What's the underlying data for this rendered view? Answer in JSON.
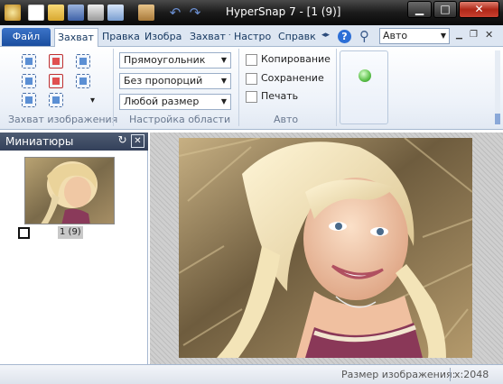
{
  "window": {
    "title": "HyperSnap 7 - [1 (9)]",
    "minimize_label": "▁",
    "maximize_label": "□",
    "close_label": "✕"
  },
  "ribbon": {
    "file_tab": "Файл",
    "tabs": [
      "Захват",
      "Правка",
      "Изобра",
      "Захват т",
      "Настро",
      "Справк"
    ],
    "active_tab": "Захват",
    "mode_select": "Авто",
    "groups": {
      "capture": {
        "label": "Захват изображения",
        "more_arrow": "▾"
      },
      "region": {
        "label": "Настройка области",
        "combos": [
          "Прямоугольник",
          "Без пропорций",
          "Любой размер"
        ]
      },
      "auto": {
        "label": "Авто",
        "checkboxes": [
          "Копирование",
          "Сохранение",
          "Печать"
        ]
      }
    }
  },
  "thumbnails": {
    "title": "Миниатюры",
    "items": [
      {
        "caption": "1 (9)"
      }
    ]
  },
  "statusbar": {
    "label": "Размер изображения:",
    "value": "x:2048"
  },
  "colors": {
    "titlebar": "#1c1c1c",
    "file_tab": "#1a4d9f",
    "ribbon_bg": "#edf2f9",
    "panel_header": "#33405a",
    "viewer_bg": "#cfcfcf"
  }
}
